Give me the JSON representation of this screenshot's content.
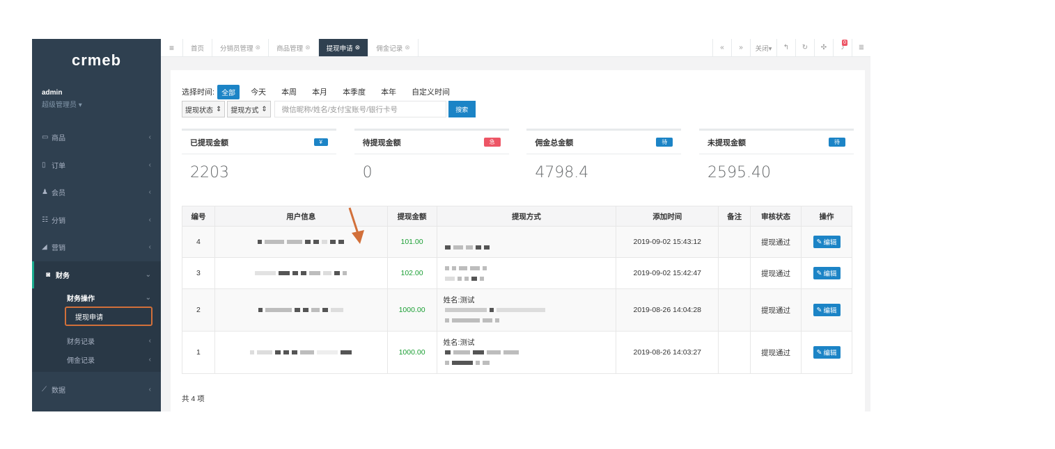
{
  "logo": "crmeb",
  "user": {
    "name": "admin",
    "role": "超级管理员 ▾"
  },
  "sidebar": {
    "items": [
      {
        "icon": "▭",
        "label": "商品"
      },
      {
        "icon": "▯",
        "label": "订单"
      },
      {
        "icon": "♟",
        "label": "会员"
      },
      {
        "icon": "☷",
        "label": "分销"
      },
      {
        "icon": "◢",
        "label": "营销"
      }
    ],
    "finance": {
      "icon": "◙",
      "label": "财务"
    },
    "finance_sub": {
      "ops": "财务操作",
      "apply": "提现申请",
      "records": "财务记录",
      "commission": "佣金记录"
    },
    "data_item": {
      "icon": "⟋",
      "label": "数据"
    }
  },
  "tabs": [
    {
      "label": "首页",
      "closable": false
    },
    {
      "label": "分销员管理",
      "closable": true
    },
    {
      "label": "商品管理",
      "closable": true
    },
    {
      "label": "提现申请",
      "closable": true,
      "active": true
    },
    {
      "label": "佣金记录",
      "closable": true
    }
  ],
  "topbar": {
    "close_label": "关闭▾",
    "notify_count": "0"
  },
  "filter": {
    "time_label": "选择时间:",
    "times": [
      "全部",
      "今天",
      "本周",
      "本月",
      "本季度",
      "本年",
      "自定义时间"
    ],
    "status_select": "提现状态",
    "method_select": "提现方式",
    "search_placeholder": "微信昵称/姓名/支付宝账号/银行卡号",
    "search_button": "搜索"
  },
  "stats": [
    {
      "title": "已提现金额",
      "badge": "¥",
      "badge_color": "#1c84c6",
      "value": "2203"
    },
    {
      "title": "待提现金额",
      "badge": "急",
      "badge_color": "#ed5565",
      "value": "0"
    },
    {
      "title": "佣金总金额",
      "badge": "待",
      "badge_color": "#1c84c6",
      "value": "4798.4"
    },
    {
      "title": "未提现金额",
      "badge": "待",
      "badge_color": "#1c84c6",
      "value": "2595.40"
    }
  ],
  "table": {
    "headers": [
      "编号",
      "用户信息",
      "提现金额",
      "提现方式",
      "添加时间",
      "备注",
      "审核状态",
      "操作"
    ],
    "rows": [
      {
        "id": "4",
        "amount": "101.00",
        "method_name": "",
        "time": "2019-09-02 15:43:12",
        "note": "",
        "status": "提现通过",
        "action": "编辑"
      },
      {
        "id": "3",
        "amount": "102.00",
        "method_name": "",
        "time": "2019-09-02 15:42:47",
        "note": "",
        "status": "提现通过",
        "action": "编辑"
      },
      {
        "id": "2",
        "amount": "1000.00",
        "method_name": "姓名:测试",
        "time": "2019-08-26 14:04:28",
        "note": "",
        "status": "提现通过",
        "action": "编辑"
      },
      {
        "id": "1",
        "amount": "1000.00",
        "method_name": "姓名:测试",
        "time": "2019-08-26 14:03:27",
        "note": "",
        "status": "提现通过",
        "action": "编辑"
      }
    ]
  },
  "total": "共 4 项",
  "colors": {
    "sidebar": "#2f4050",
    "primary": "#1c84c6",
    "danger": "#ed5565",
    "money": "#1a9e33",
    "highlight": "#d2703a"
  }
}
